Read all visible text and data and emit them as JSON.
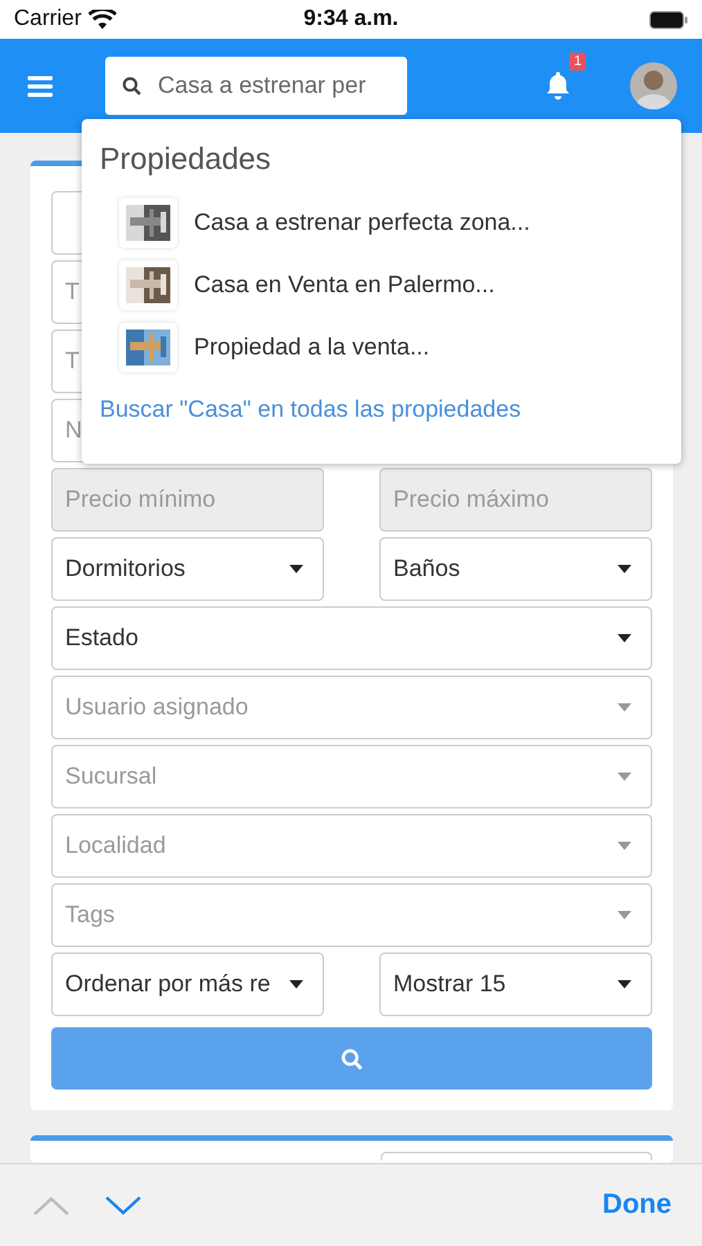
{
  "status_bar": {
    "carrier": "Carrier",
    "time": "9:34 a.m."
  },
  "header": {
    "search": {
      "value": "Casa a estrenar per"
    },
    "notifications": {
      "badge": "1"
    }
  },
  "suggestions": {
    "title": "Propiedades",
    "items": [
      {
        "label": "Casa a estrenar perfecta zona..."
      },
      {
        "label": "Casa en Venta en Palermo..."
      },
      {
        "label": "Propiedad a la venta..."
      }
    ],
    "search_all": "Buscar \"Casa\" en todas las propiedades"
  },
  "filters": [
    [
      {
        "kind": "text",
        "disabled": false
      }
    ],
    [
      {
        "kind": "text",
        "placeholder": "T",
        "disabled": false
      }
    ],
    [
      {
        "kind": "text",
        "placeholder": "T",
        "disabled": false
      }
    ],
    [
      {
        "kind": "text",
        "placeholder": "N",
        "disabled": false
      }
    ],
    [
      {
        "kind": "text",
        "placeholder": "Precio mínimo",
        "disabled": true
      },
      {
        "kind": "text",
        "placeholder": "Precio máximo",
        "disabled": true
      }
    ],
    [
      {
        "kind": "select",
        "value": "Dormitorios",
        "disabled": false
      },
      {
        "kind": "select",
        "value": "Baños",
        "disabled": false
      }
    ],
    [
      {
        "kind": "select",
        "value": "Estado",
        "disabled": false
      }
    ],
    [
      {
        "kind": "select",
        "placeholder": "Usuario asignado",
        "disabled": false
      }
    ],
    [
      {
        "kind": "select",
        "placeholder": "Sucursal",
        "disabled": false
      }
    ],
    [
      {
        "kind": "select",
        "placeholder": "Localidad",
        "disabled": false
      }
    ],
    [
      {
        "kind": "select",
        "placeholder": "Tags",
        "disabled": false
      }
    ],
    [
      {
        "kind": "select",
        "value": "Ordenar por más re",
        "disabled": false
      },
      {
        "kind": "select",
        "value": "Mostrar 15",
        "disabled": false
      }
    ]
  ],
  "accessory_bar": {
    "previous_disabled": true,
    "next_disabled": false,
    "done": "Done"
  }
}
